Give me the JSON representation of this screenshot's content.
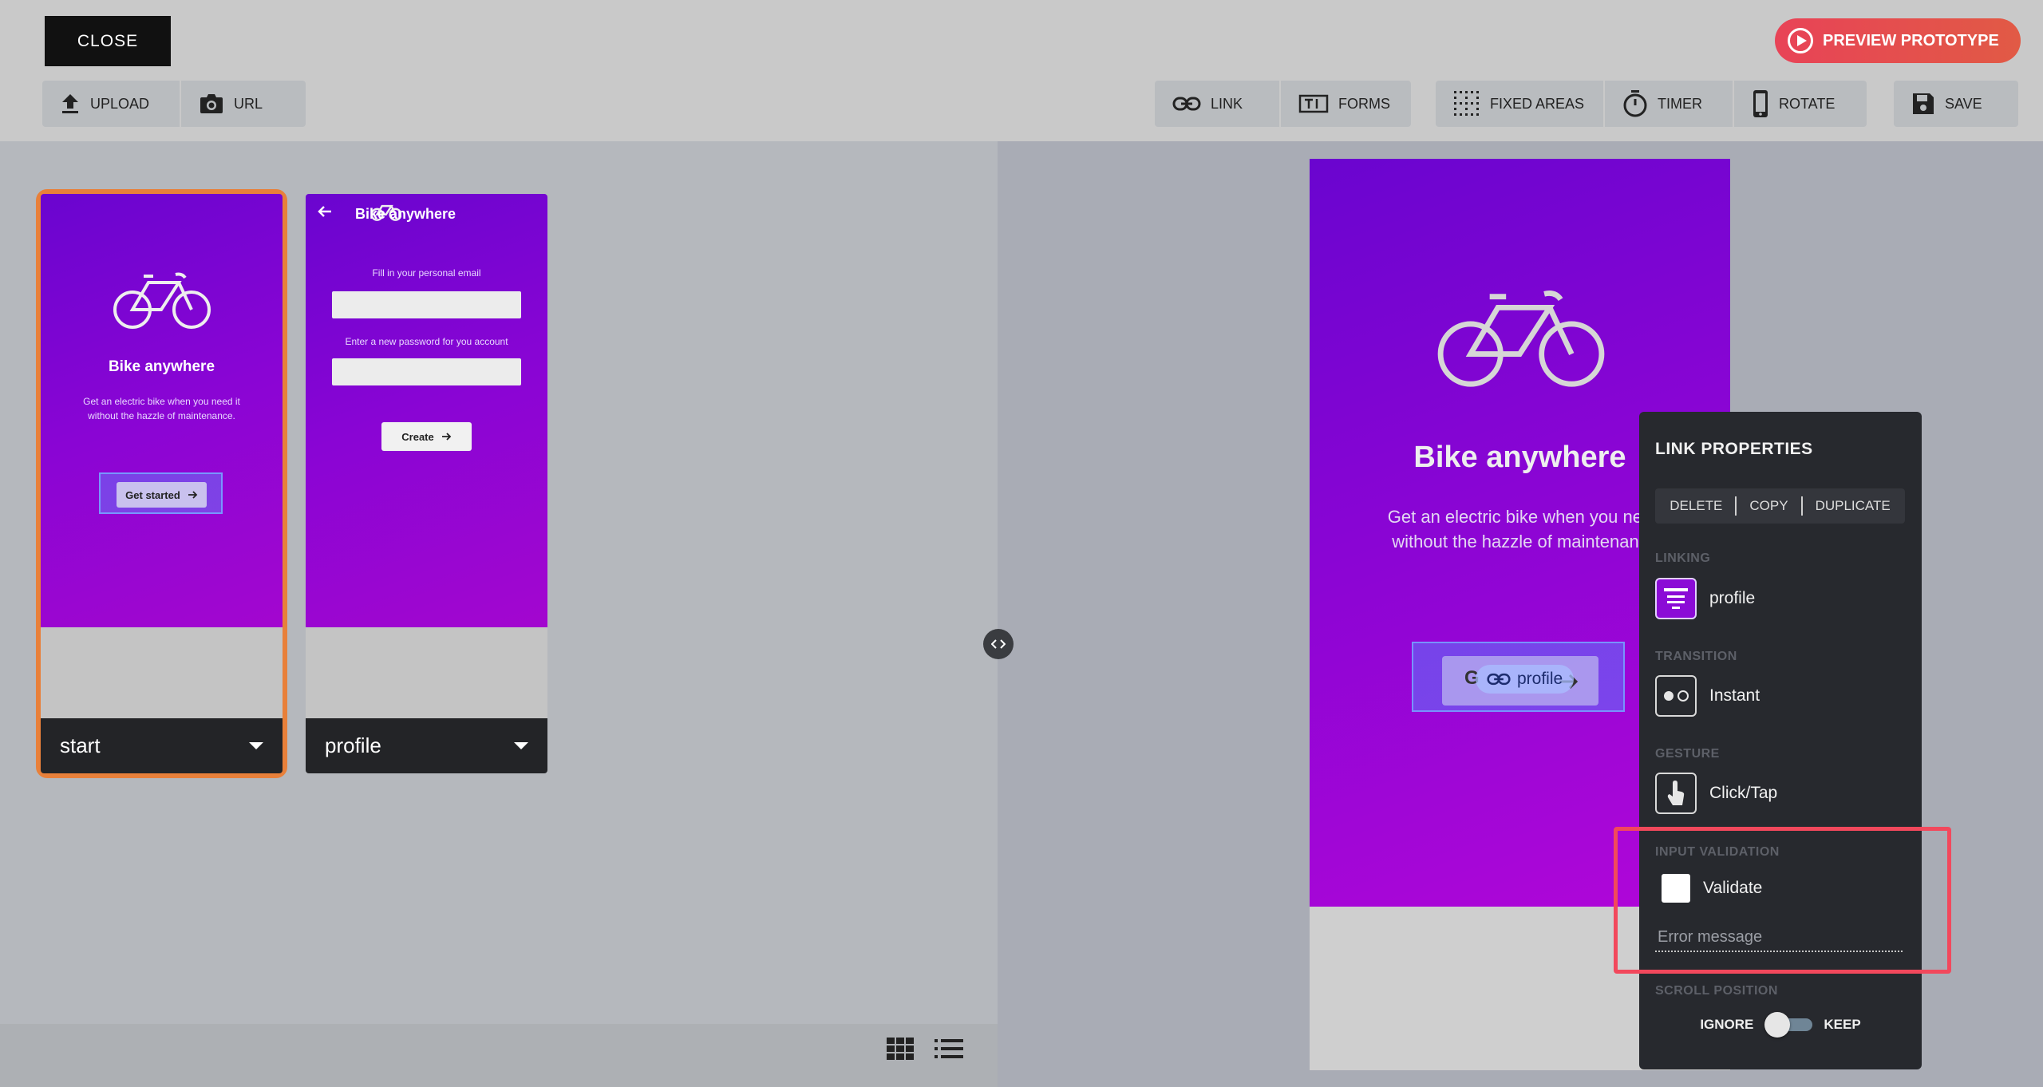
{
  "toolbar": {
    "close_label": "CLOSE",
    "preview_label": "PREVIEW PROTOTYPE",
    "upload_label": "UPLOAD",
    "url_label": "URL",
    "link_label": "LINK",
    "forms_label": "FORMS",
    "fixed_areas_label": "FIXED AREAS",
    "timer_label": "TIMER",
    "rotate_label": "ROTATE",
    "save_label": "SAVE"
  },
  "screens": [
    {
      "name": "start",
      "title": "Bike anywhere",
      "text_line1": "Get an electric bike when you need it",
      "text_line2": "without the hazzle of maintenance.",
      "button": "Get started"
    },
    {
      "name": "profile",
      "header": "Bike anywhere",
      "email_label": "Fill in your personal email",
      "password_label": "Enter a new password for you account",
      "button": "Create"
    }
  ],
  "canvas": {
    "title": "Bike anywhere",
    "text_line1": "Get an electric bike when you nee",
    "text_line2": "without the hazzle of maintenanc",
    "button_partial": "G",
    "link_chip": "profile"
  },
  "link_properties": {
    "title": "LINK PROPERTIES",
    "delete": "DELETE",
    "copy": "COPY",
    "duplicate": "DUPLICATE",
    "linking_label": "LINKING",
    "linking_value": "profile",
    "transition_label": "TRANSITION",
    "transition_value": "Instant",
    "gesture_label": "GESTURE",
    "gesture_value": "Click/Tap",
    "validation_label": "INPUT VALIDATION",
    "validate_label": "Validate",
    "error_placeholder": "Error message",
    "scroll_label": "SCROLL POSITION",
    "ignore": "IGNORE",
    "keep": "KEEP"
  },
  "colors": {
    "accent_orange": "#e8803a",
    "preview_red": "#e84357",
    "highlight_red": "#f2485c",
    "screen_purple": "#8a05d4",
    "panel_dark": "#27292e"
  }
}
